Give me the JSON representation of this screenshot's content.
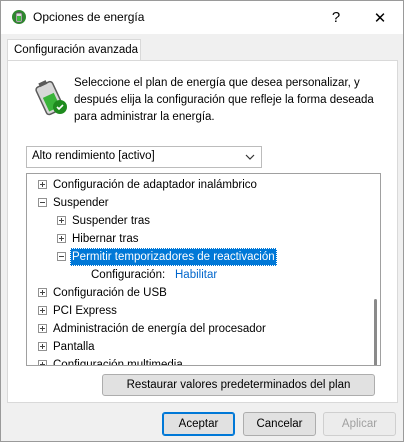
{
  "window": {
    "title": "Opciones de energía",
    "help_label": "?",
    "close_label": "✕"
  },
  "tab": {
    "label": "Configuración avanzada"
  },
  "description": "Seleccione el plan de energía que desea personalizar, y después elija la configuración que refleje la forma deseada para administrar la energía.",
  "plan_dropdown": {
    "selected": "Alto rendimiento [activo]"
  },
  "tree": {
    "items": [
      {
        "label": "Configuración de adaptador inalámbrico",
        "expander": "plus"
      },
      {
        "label": "Suspender",
        "expander": "minus"
      },
      {
        "label": "Suspender tras",
        "expander": "plus"
      },
      {
        "label": "Hibernar tras",
        "expander": "plus"
      },
      {
        "label": "Permitir temporizadores de reactivación",
        "expander": "minus",
        "selected": true
      },
      {
        "label": "Configuración:",
        "value": "Habilitar"
      },
      {
        "label": "Configuración de USB",
        "expander": "plus"
      },
      {
        "label": "PCI Express",
        "expander": "plus"
      },
      {
        "label": "Administración de energía del procesador",
        "expander": "plus"
      },
      {
        "label": "Pantalla",
        "expander": "plus"
      },
      {
        "label": "Configuración multimedia",
        "expander": "plus"
      }
    ]
  },
  "buttons": {
    "restore": "Restaurar valores predeterminados del plan",
    "accept": "Aceptar",
    "cancel": "Cancelar",
    "apply": "Aplicar"
  },
  "colors": {
    "selection": "#0078d7",
    "link": "#0066cc"
  }
}
